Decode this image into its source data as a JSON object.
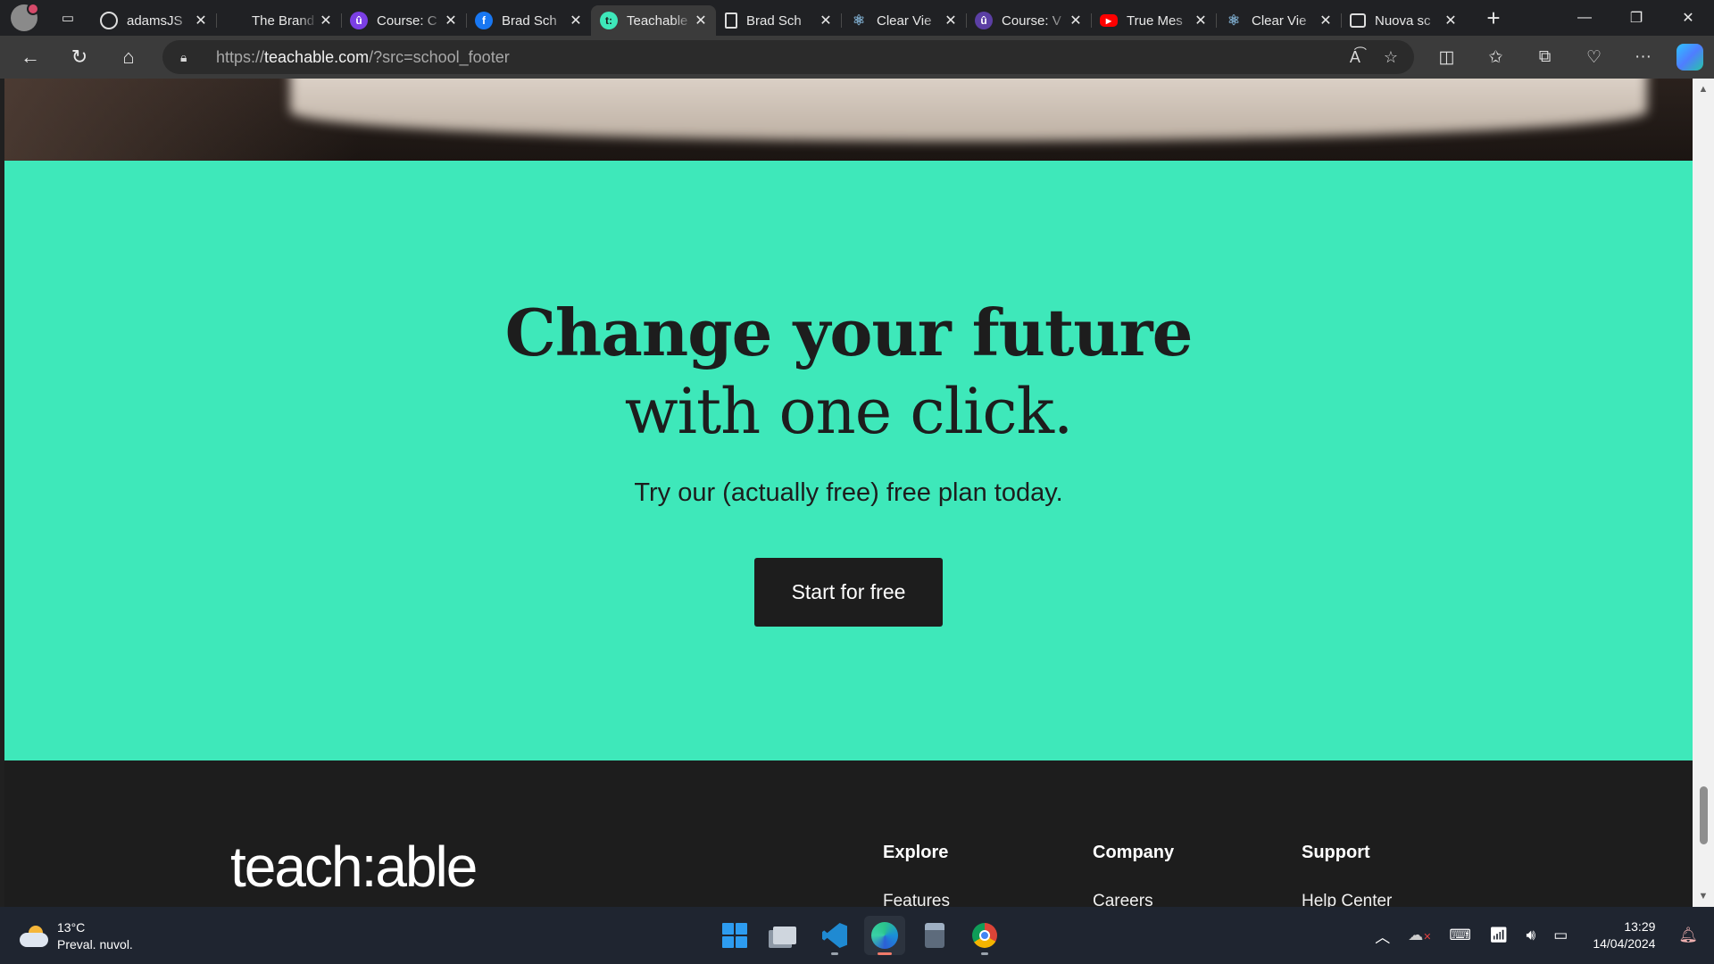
{
  "browser": {
    "tabs": [
      {
        "title": "adamsJS",
        "favicon": "github-icon",
        "color": "#2b2b2b",
        "active": false
      },
      {
        "title": "The Brand",
        "favicon": "blank-icon",
        "color": "#202124",
        "active": false
      },
      {
        "title": "Course: C",
        "favicon": "teachable-course-icon",
        "color": "#7b3fe4",
        "active": false
      },
      {
        "title": "Brad Sch",
        "favicon": "facebook-icon",
        "color": "#1877f2",
        "active": false
      },
      {
        "title": "Teachable",
        "favicon": "teachable-icon",
        "color": "#3ee8ba",
        "active": true
      },
      {
        "title": "Brad Sch",
        "favicon": "page-icon",
        "color": "#202124",
        "active": false
      },
      {
        "title": "Clear Vie",
        "favicon": "react-icon",
        "color": "#202124",
        "active": false
      },
      {
        "title": "Course: V",
        "favicon": "teachable-course-icon",
        "color": "#5b3fa4",
        "active": false
      },
      {
        "title": "True Mes",
        "favicon": "youtube-icon",
        "color": "#ff0000",
        "active": false
      },
      {
        "title": "Clear Vie",
        "favicon": "react-icon",
        "color": "#202124",
        "active": false
      },
      {
        "title": "Nuova sc",
        "favicon": "newtab-icon",
        "color": "#202124",
        "active": false
      }
    ],
    "url_scheme": "https://",
    "url_host": "teachable.com",
    "url_path": "/?src=school_footer"
  },
  "page": {
    "cta_heading_bold": "Change your future",
    "cta_heading_light": "with one click.",
    "cta_subtext": "Try our (actually free) free plan today.",
    "cta_button": "Start for free",
    "accent_color": "#3ee8ba",
    "footer": {
      "logo": "teach:able",
      "columns": [
        {
          "heading": "Explore",
          "first_link": "Features"
        },
        {
          "heading": "Company",
          "first_link": "Careers"
        },
        {
          "heading": "Support",
          "first_link": "Help Center"
        }
      ]
    }
  },
  "taskbar": {
    "weather_temp": "13°C",
    "weather_desc": "Preval. nuvol.",
    "time": "13:29",
    "date": "14/04/2024"
  }
}
